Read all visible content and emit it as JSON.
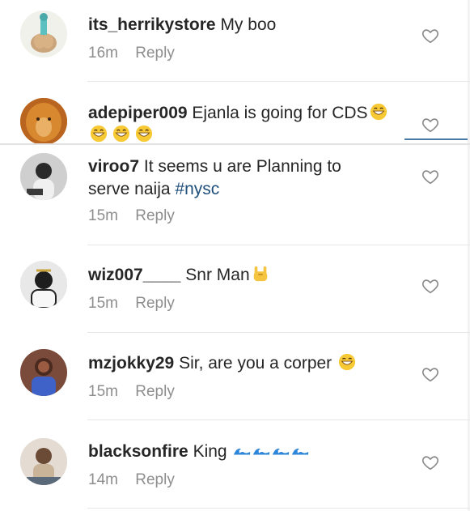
{
  "comments": [
    {
      "username": "its_herrikystore",
      "text": "My boo",
      "time": "16m",
      "reply": "Reply"
    },
    {
      "username": "adepiper009",
      "text": "Ejanla is going for CDS",
      "time": "",
      "reply": ""
    },
    {
      "username": "viroo7",
      "text": "It seems u are Planning to",
      "text2": "serve naija",
      "hashtag": "#nysc",
      "time": "15m",
      "reply": "Reply"
    },
    {
      "username": "wiz007____",
      "text": "Snr Man",
      "time": "15m",
      "reply": "Reply"
    },
    {
      "username": "mzjokky29",
      "text": "Sir, are you a corper",
      "time": "15m",
      "reply": "Reply"
    },
    {
      "username": "blacksonfire",
      "text": "King",
      "time": "14m",
      "reply": "Reply"
    }
  ],
  "icons": {
    "like": "heart-outline-icon",
    "grin": "grinning-face-emoji",
    "horns": "sign-of-horns-emoji",
    "wave": "water-wave-emoji"
  },
  "colors": {
    "username": "#262626",
    "meta": "#8e8e8e",
    "hashtag": "#1f4f7a",
    "divider": "#e7e7e7"
  }
}
